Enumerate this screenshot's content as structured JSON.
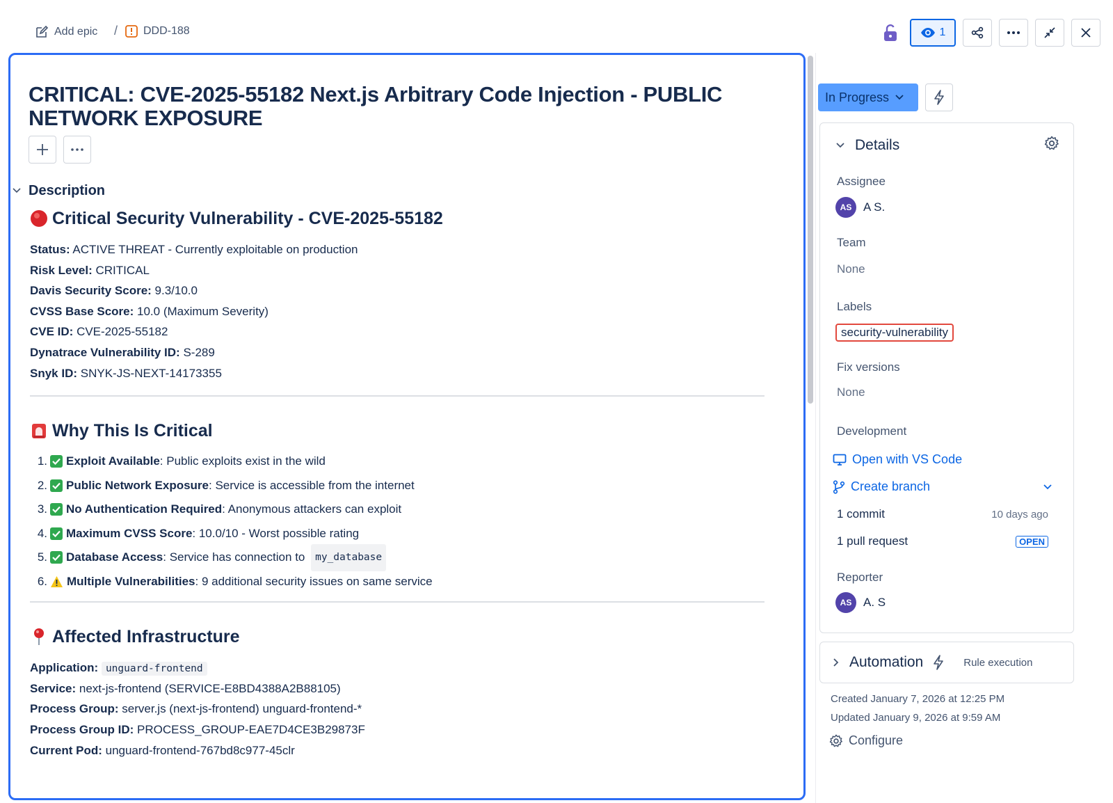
{
  "breadcrumb": {
    "add_epic": "Add epic",
    "separator": "/",
    "issue_key": "DDD-188"
  },
  "toolbar": {
    "watch_count": "1"
  },
  "issue": {
    "title": "CRITICAL: CVE-2025-55182 Next.js Arbitrary Code Injection - PUBLIC NETWORK EXPOSURE",
    "description_label": "Description",
    "heading_main": "Critical Security Vulnerability - CVE-2025-55182",
    "fields": [
      {
        "k": "Status:",
        "v": " ACTIVE THREAT - Currently exploitable on production"
      },
      {
        "k": "Risk Level:",
        "v": " CRITICAL"
      },
      {
        "k": "Davis Security Score:",
        "v": " 9.3/10.0"
      },
      {
        "k": "CVSS Base Score:",
        "v": " 10.0 (Maximum Severity)"
      },
      {
        "k": "CVE ID:",
        "v": " CVE-2025-55182"
      },
      {
        "k": "Dynatrace Vulnerability ID:",
        "v": " S-289"
      },
      {
        "k": "Snyk ID:",
        "v": " SNYK-JS-NEXT-14173355"
      }
    ],
    "heading_why": "Why This Is Critical",
    "why_items": [
      {
        "n": "1.",
        "b": "Exploit Available",
        "t": ": Public exploits exist in the wild",
        "icon": "check"
      },
      {
        "n": "2.",
        "b": "Public Network Exposure",
        "t": ": Service is accessible from the internet",
        "icon": "check"
      },
      {
        "n": "3.",
        "b": "No Authentication Required",
        "t": ": Anonymous attackers can exploit",
        "icon": "check"
      },
      {
        "n": "4.",
        "b": "Maximum CVSS Score",
        "t": ": 10.0/10 - Worst possible rating",
        "icon": "check"
      },
      {
        "n": "5.",
        "b": "Database Access",
        "t": ": Service has connection to ",
        "code": "my_database",
        "icon": "check"
      },
      {
        "n": "6.",
        "b": "Multiple Vulnerabilities",
        "t": ": 9 additional security issues on same service",
        "icon": "warning"
      }
    ],
    "heading_infra": "Affected Infrastructure",
    "infra": {
      "application_k": "Application:",
      "application_v": "unguard-frontend",
      "service_k": "Service:",
      "service_v": " next-js-frontend (SERVICE-E8BD4388A2B88105)",
      "pg_k": "Process Group:",
      "pg_v": " server.js (next-js-frontend) unguard-frontend-*",
      "pgid_k": "Process Group ID:",
      "pgid_v": " PROCESS_GROUP-EAE7D4CE3B29873F",
      "pod_k": "Current Pod:",
      "pod_v": " unguard-frontend-767bd8c977-45clr"
    }
  },
  "sidebar": {
    "status": "In Progress",
    "details_title": "Details",
    "assignee_label": "Assignee",
    "assignee_initials": "AS",
    "assignee_name": "A S.",
    "team_label": "Team",
    "team_value": "None",
    "labels_label": "Labels",
    "label_chip": "security-vulnerability",
    "fix_versions_label": "Fix versions",
    "fix_versions_value": "None",
    "development_label": "Development",
    "open_vscode": "Open with VS Code",
    "create_branch": "Create branch",
    "commit": "1 commit",
    "commit_time": "10 days ago",
    "pull_request": "1 pull request",
    "pr_status": "OPEN",
    "reporter_label": "Reporter",
    "reporter_initials": "AS",
    "reporter_name": "A. S",
    "automation_title": "Automation",
    "automation_sub": "Rule execution",
    "created": "Created January 7, 2026 at 12:25 PM",
    "updated": "Updated January 9, 2026 at 9:59 AM",
    "configure": "Configure"
  },
  "colors": {
    "accent": "#0c66e4",
    "status_bg": "#579dff",
    "focus_border": "#2c6cf5",
    "check": "#2fa84f",
    "label_border": "#e2483d",
    "avatar": "#5243aa"
  }
}
